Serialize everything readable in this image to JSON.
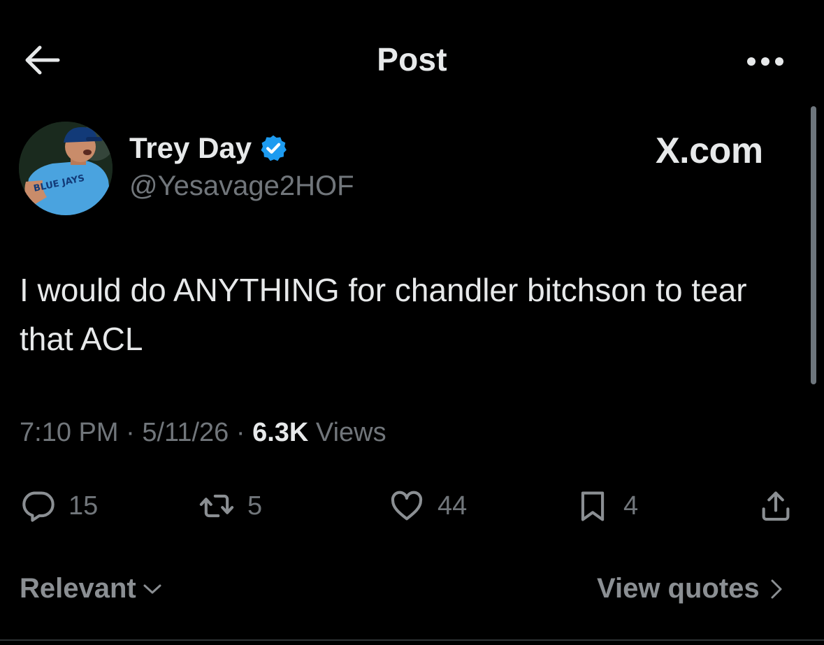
{
  "header": {
    "title": "Post",
    "back_icon": "arrow-left-icon",
    "more_icon": "more-horizontal-icon"
  },
  "author": {
    "name": "Trey Day",
    "handle": "@Yesavage2HOF",
    "verified": true,
    "verified_color": "#1d9bf0",
    "jersey_text": "BLUE JAYS"
  },
  "source": "X.com",
  "tweet": {
    "text": "I would do ANYTHING for chandler bitchson to tear that ACL"
  },
  "meta": {
    "time": "7:10 PM",
    "separator": " · ",
    "date": "5/11/26",
    "views_count": "6.3K",
    "views_label": "Views"
  },
  "actions": {
    "reply_count": "15",
    "repost_count": "5",
    "like_count": "44",
    "bookmark_count": "4"
  },
  "footer": {
    "sort_label": "Relevant",
    "quotes_label": "View quotes"
  },
  "colors": {
    "background": "#000000",
    "primary_text": "#e7e9ea",
    "secondary_text": "#71767b",
    "accent": "#1d9bf0"
  }
}
